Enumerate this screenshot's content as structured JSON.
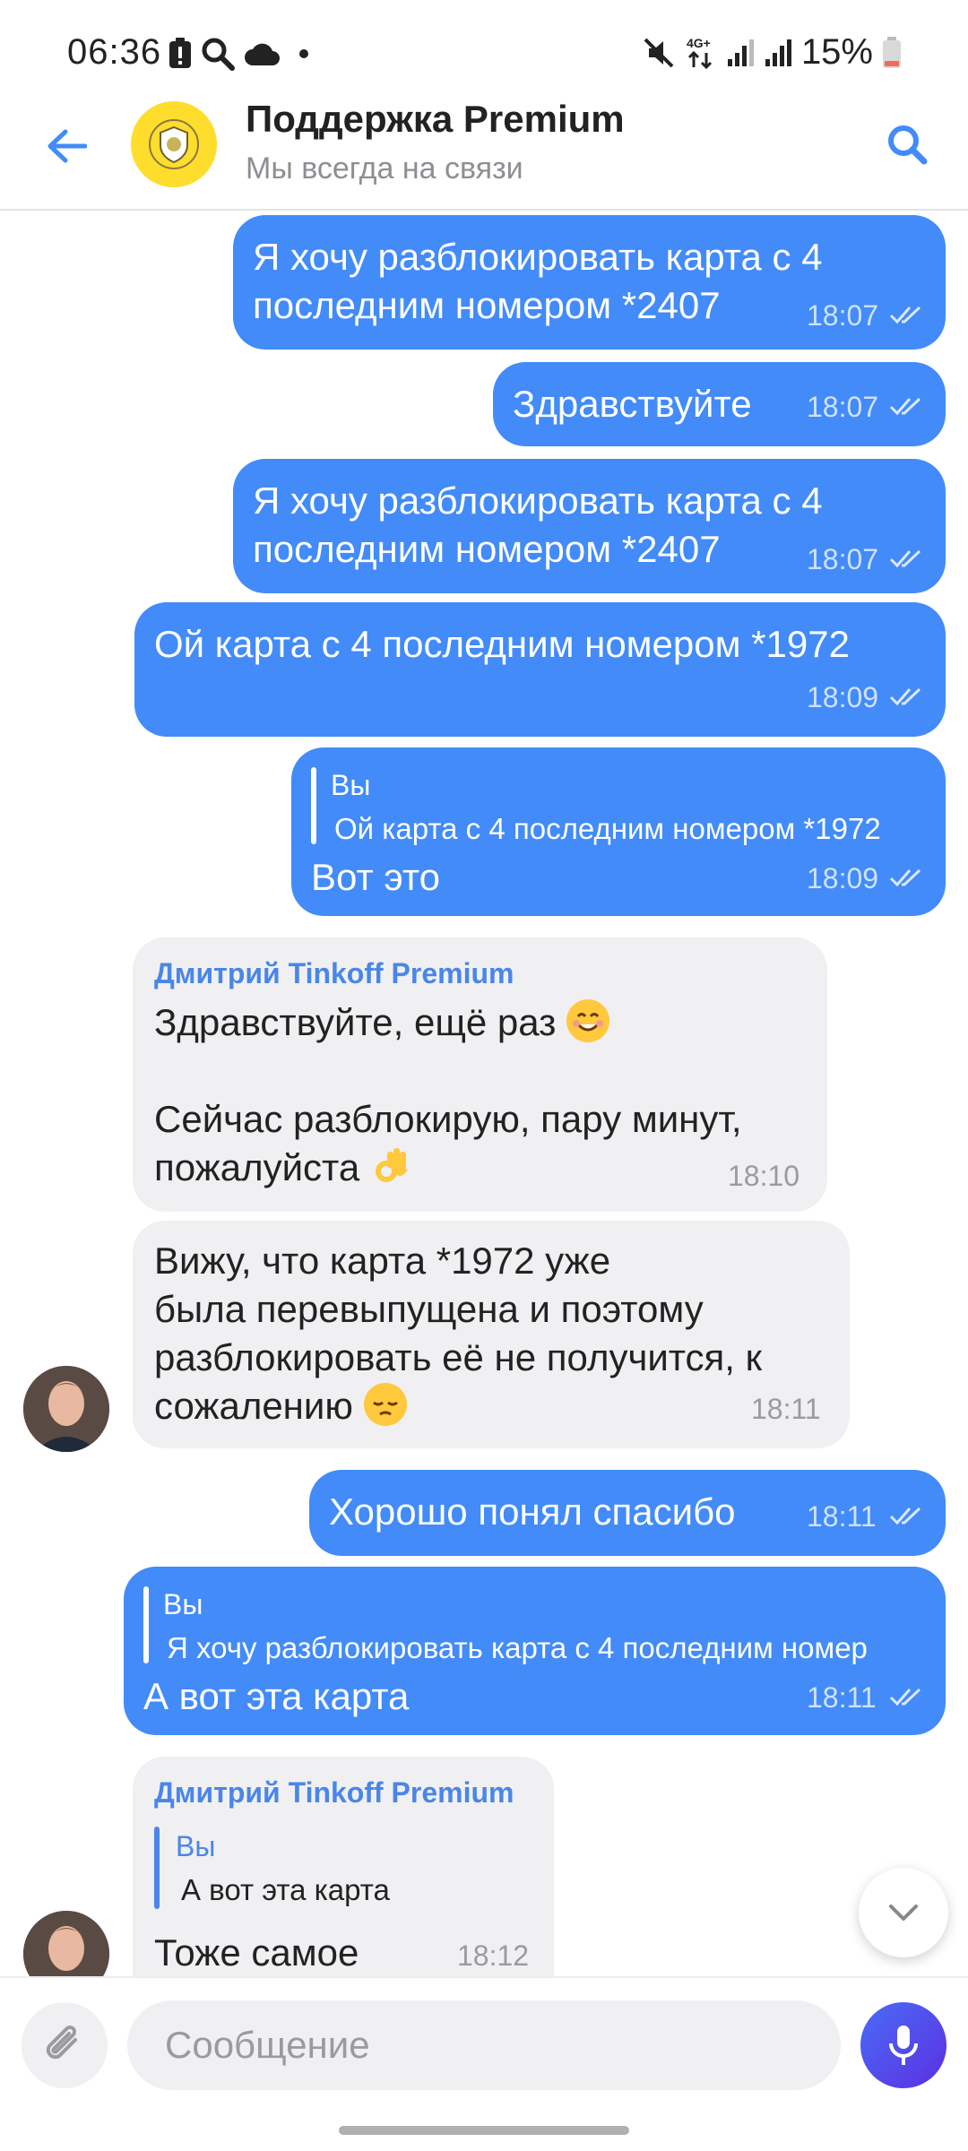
{
  "status_bar": {
    "time": "06:36",
    "battery_percent": "15%",
    "network": "4G+",
    "icons_left": [
      "alert-icon",
      "search-icon",
      "cloud-icon",
      "dot-icon"
    ],
    "icons_right": [
      "mute-icon",
      "network-icon",
      "signal-icon",
      "signal-icon",
      "battery-icon"
    ]
  },
  "header": {
    "title": "Поддержка Premium",
    "subtitle": "Мы всегда на связи",
    "accent": "#428bf9",
    "logo_color": "#ffdd2d"
  },
  "messages": [
    {
      "dir": "out",
      "text_l1": "Я хочу разблокировать карта с 4",
      "text_l2": "последним номером *2407",
      "time": "18:07"
    },
    {
      "dir": "out",
      "text": "Здравствуйте",
      "time": "18:07"
    },
    {
      "dir": "out",
      "text_l1": "Я хочу разблокировать карта с 4",
      "text_l2": "последним номером *2407",
      "time": "18:07"
    },
    {
      "dir": "out",
      "text": "Ой карта с 4 последним номером *1972",
      "time": "18:09"
    },
    {
      "dir": "out",
      "quote_name": "Вы",
      "quote_text": "Ой карта с 4 последним номером *1972",
      "text": "Вот это",
      "time": "18:09"
    },
    {
      "dir": "in",
      "sender": "Дмитрий Tinkoff Premium",
      "text_l1": "Здравствуйте, ещё раз",
      "text_l2": "Сейчас разблокирую, пару минут,",
      "text_l3": "пожалуйста",
      "time": "18:10"
    },
    {
      "dir": "in",
      "text_l1": "Вижу, что карта *1972 уже",
      "text_l2": "была перевыпущена и поэтому",
      "text_l3": "разблокировать её не получится, к",
      "text_l4": "сожалению",
      "time": "18:11"
    },
    {
      "dir": "out",
      "text": "Хорошо понял спасибо",
      "time": "18:11"
    },
    {
      "dir": "out",
      "quote_name": "Вы",
      "quote_text": "Я хочу разблокировать карта с 4 последним номер",
      "text": "А вот эта карта",
      "time": "18:11"
    },
    {
      "dir": "in",
      "sender": "Дмитрий Tinkoff Premium",
      "quote_name": "Вы",
      "quote_text": "А вот эта карта",
      "text": "Тоже самое",
      "time": "18:12"
    }
  ],
  "composer": {
    "placeholder": "Сообщение"
  },
  "colors": {
    "outgoing_bubble": "#428bf9",
    "incoming_bubble": "#f0f0f2",
    "sender_name": "#4a86e8",
    "mic_gradient": [
      "#4a6cf7",
      "#5b2fe0"
    ]
  }
}
